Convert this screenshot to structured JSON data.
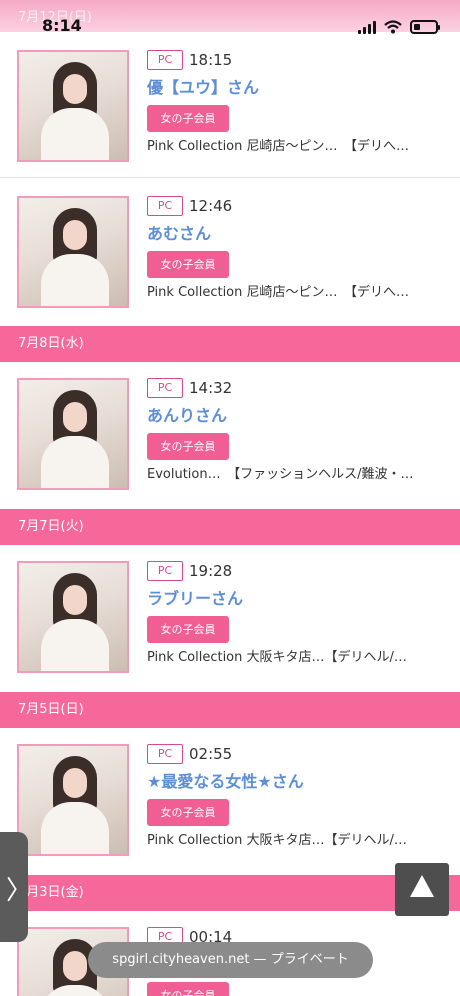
{
  "status_bar": {
    "time": "8:14",
    "date_behind": "7月12日(日)"
  },
  "entries": [
    {
      "pc": "PC",
      "time": "18:15",
      "name": "優【ユウ】さん",
      "tag": "女の子会員",
      "shop": "Pink Collection 尼崎店～ピン…　【デリへ…"
    },
    {
      "pc": "PC",
      "time": "12:46",
      "name": "あむさん",
      "tag": "女の子会員",
      "shop": "Pink Collection 尼崎店～ピン…　【デリへ…"
    },
    {
      "pc": "PC",
      "time": "14:32",
      "name": "あんりさん",
      "tag": "女の子会員",
      "shop": "Evolution…　【ファッションヘルス/難波・…"
    },
    {
      "pc": "PC",
      "time": "19:28",
      "name": "ラブリーさん",
      "tag": "女の子会員",
      "shop": "Pink Collection 大阪キタ店…【デリヘル/…"
    },
    {
      "pc": "PC",
      "time": "02:55",
      "name": "★最愛なる女性★さん",
      "tag": "女の子会員",
      "shop": "Pink Collection 大阪キタ店…【デリヘル/…"
    },
    {
      "pc": "PC",
      "time": "00:14",
      "name": "",
      "tag": "女の子会員",
      "shop": ""
    }
  ],
  "date_headers": [
    "7月8日(水)",
    "7月7日(火)",
    "7月5日(日)",
    "7月3日(金)"
  ],
  "side_tab_glyph": "〉",
  "scroll_top_icon": "triangle-up-icon",
  "url_bar": {
    "text": "spgirl.cityheaven.net — プライベート"
  }
}
